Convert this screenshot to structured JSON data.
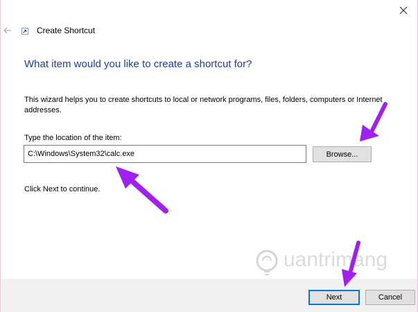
{
  "window": {
    "title": "Create Shortcut",
    "close_symbol": "✕"
  },
  "icons": {
    "back": "back-arrow-icon",
    "app": "shortcut-icon",
    "close": "close-icon",
    "watermark": "lightbulb-logo-icon"
  },
  "wizard": {
    "heading": "What item would you like to create a shortcut for?",
    "description": "This wizard helps you to create shortcuts to local or network programs, files, folders, computers or Internet addresses.",
    "location_label": "Type the location of the item:",
    "location_value": "C:\\Windows\\System32\\calc.exe",
    "browse_label": "Browse...",
    "continue_text": "Click Next to continue."
  },
  "footer": {
    "next_label": "Next",
    "cancel_label": "Cancel"
  },
  "watermark": {
    "text": "uantrimang"
  },
  "colors": {
    "heading": "#1a3fa0",
    "focus_border": "#0078d7",
    "annotation_arrow": "#a020f0",
    "footer_bg": "#f0f0f0",
    "button_bg": "#e1e1e1"
  }
}
